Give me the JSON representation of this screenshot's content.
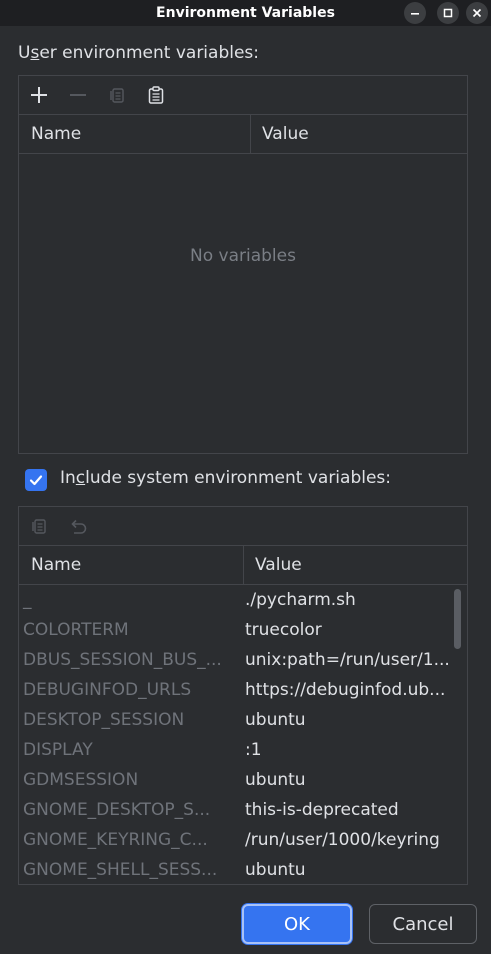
{
  "window": {
    "title": "Environment Variables"
  },
  "user_section": {
    "label_prefix": "U",
    "label_mnemonic": "s",
    "label_suffix": "er environment variables:",
    "columns": [
      "Name",
      "Value"
    ],
    "empty_text": "No variables",
    "toolbar": [
      "add-icon",
      "remove-icon",
      "copy-icon",
      "paste-icon"
    ]
  },
  "system_section": {
    "checkbox_checked": true,
    "label_prefix": "In",
    "label_mnemonic": "c",
    "label_suffix": "lude system environment variables:",
    "columns": [
      "Name",
      "Value"
    ],
    "toolbar": [
      "copy-icon",
      "undo-icon"
    ],
    "rows": [
      {
        "name": "_",
        "value": "./pycharm.sh"
      },
      {
        "name": "COLORTERM",
        "value": "truecolor"
      },
      {
        "name": "DBUS_SESSION_BUS_...",
        "value": "unix:path=/run/user/1..."
      },
      {
        "name": "DEBUGINFOD_URLS",
        "value": "https://debuginfod.ub..."
      },
      {
        "name": "DESKTOP_SESSION",
        "value": "ubuntu"
      },
      {
        "name": "DISPLAY",
        "value": ":1"
      },
      {
        "name": "GDMSESSION",
        "value": "ubuntu"
      },
      {
        "name": "GNOME_DESKTOP_S...",
        "value": "this-is-deprecated"
      },
      {
        "name": "GNOME_KEYRING_C...",
        "value": "/run/user/1000/keyring"
      },
      {
        "name": "GNOME_SHELL_SESS...",
        "value": "ubuntu"
      }
    ]
  },
  "buttons": {
    "ok": "OK",
    "cancel": "Cancel"
  },
  "colors": {
    "accent": "#3574f0",
    "background": "#2b2d30",
    "titlebar": "#1e1f22"
  }
}
